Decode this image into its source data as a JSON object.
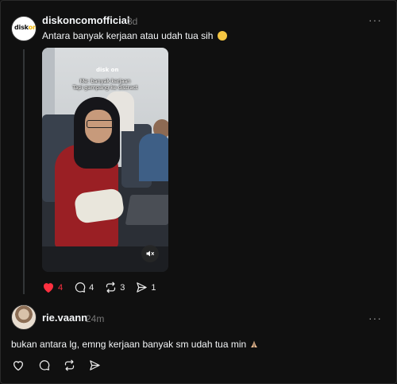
{
  "post": {
    "avatar_text": "disk",
    "avatar_text_accent": "on",
    "username": "diskoncomofficial",
    "time": "3d",
    "more_label": "···",
    "text": "Antara banyak kerjaan atau udah tua sih",
    "emoji": "smiling-face-with-tear",
    "media": {
      "watermark": "disk on",
      "caption_line1": "Me: banyak kerjaan",
      "caption_line2": "Tapi gampang ke distract",
      "muted": true
    },
    "stats": {
      "likes": "4",
      "replies": "4",
      "reposts": "3",
      "shares": "1"
    },
    "liked": true
  },
  "reply": {
    "username": "rie.vaann",
    "time": "24m",
    "more_label": "···",
    "text": "bukan antara lg, emng kerjaan banyak sm udah tua min",
    "emoji": "folded-hands"
  },
  "colors": {
    "background": "#101010",
    "like": "#ff3040",
    "muted_text": "#777777",
    "thread_line": "#333638"
  }
}
